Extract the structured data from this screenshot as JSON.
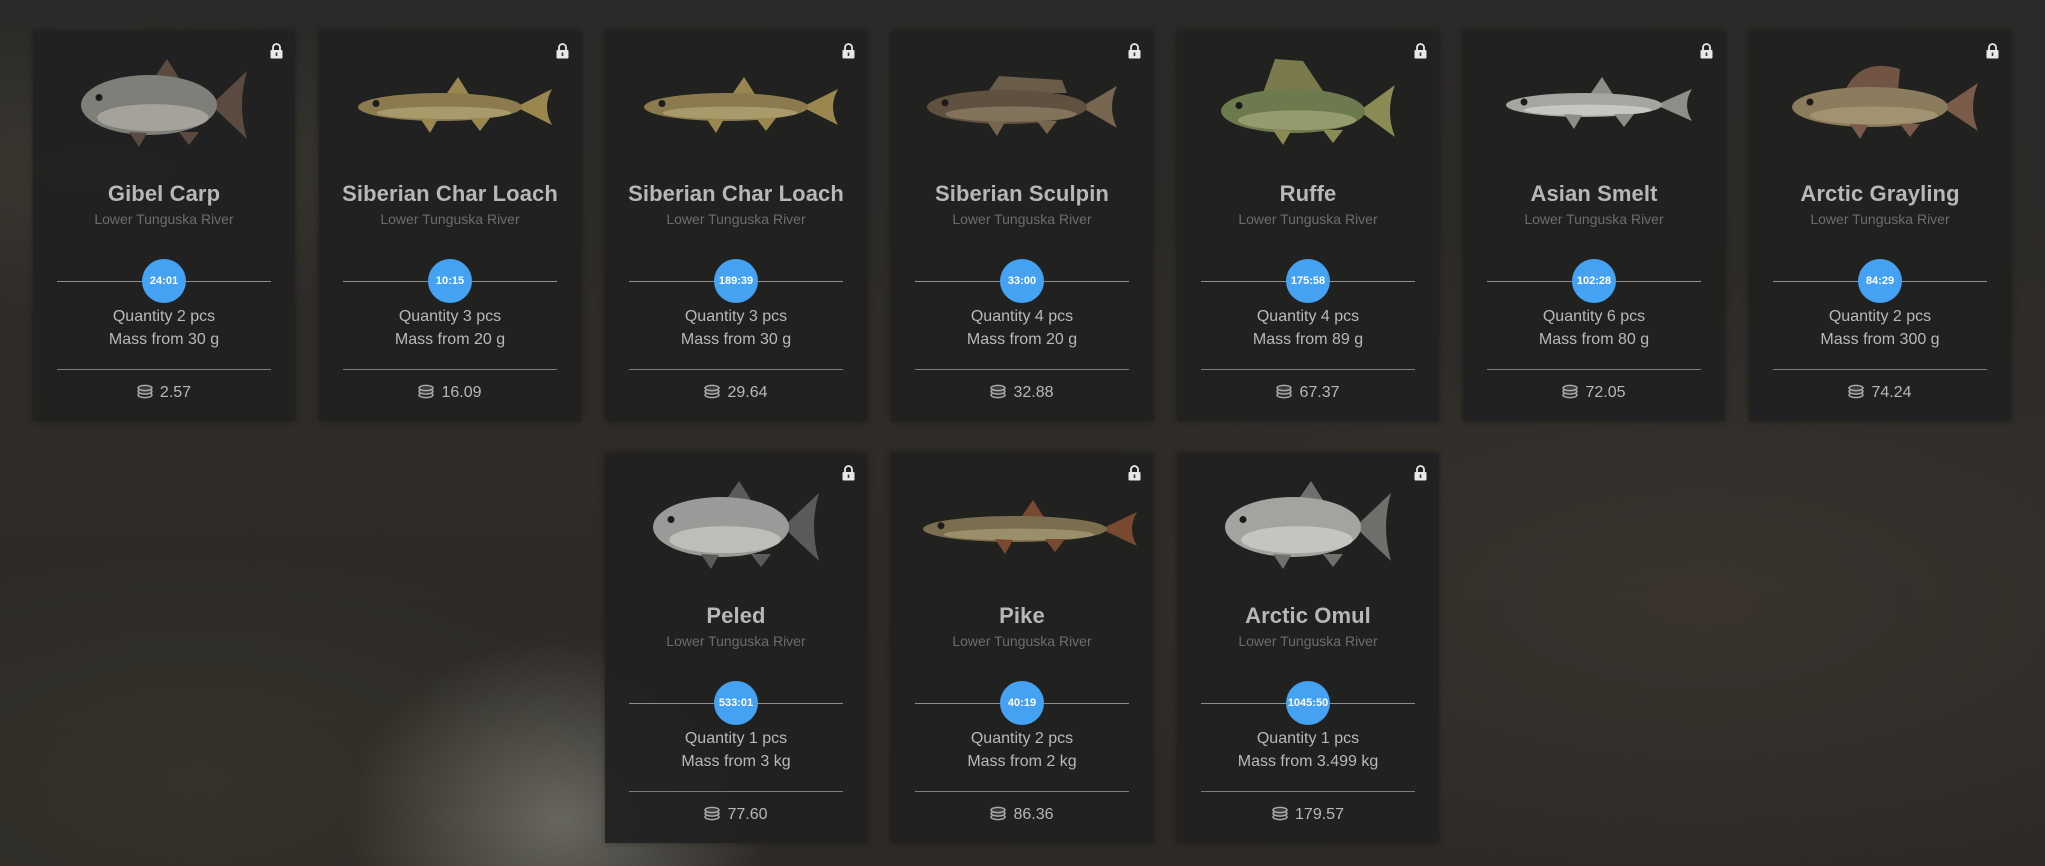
{
  "colors": {
    "accent_timer": "#45a2f2",
    "card_bg": "#202020",
    "name_text": "#b7b7b7",
    "location_text": "#6c6c6c"
  },
  "cards": [
    {
      "name": "Gibel Carp",
      "location": "Lower Tunguska River",
      "timer": "24:01",
      "quantity": "Quantity 2 pcs",
      "mass": "Mass from 30 g",
      "price": "2.57",
      "locked": true,
      "icon": "lock-icon",
      "fish": {
        "body": "#7f7f7a",
        "fin": "#5a4a3f",
        "belly": "#b0aea6",
        "shape": "deep"
      }
    },
    {
      "name": "Siberian Char Loach",
      "location": "Lower Tunguska River",
      "timer": "10:15",
      "quantity": "Quantity 3 pcs",
      "mass": "Mass from 20 g",
      "price": "16.09",
      "locked": true,
      "icon": "lock-icon",
      "fish": {
        "body": "#8a7a4e",
        "fin": "#9a8750",
        "belly": "#b3a577",
        "shape": "long"
      }
    },
    {
      "name": "Siberian Char Loach",
      "location": "Lower Tunguska River",
      "timer": "189:39",
      "quantity": "Quantity 3 pcs",
      "mass": "Mass from 30 g",
      "price": "29.64",
      "locked": true,
      "icon": "lock-icon",
      "fish": {
        "body": "#8a7a4e",
        "fin": "#9a8750",
        "belly": "#b3a577",
        "shape": "long"
      }
    },
    {
      "name": "Siberian Sculpin",
      "location": "Lower Tunguska River",
      "timer": "33:00",
      "quantity": "Quantity 4 pcs",
      "mass": "Mass from 20 g",
      "price": "32.88",
      "locked": true,
      "icon": "lock-icon",
      "fish": {
        "body": "#5e5140",
        "fin": "#766650",
        "belly": "#8e7f66",
        "shape": "sculpin"
      }
    },
    {
      "name": "Ruffe",
      "location": "Lower Tunguska River",
      "timer": "175:58",
      "quantity": "Quantity 4 pcs",
      "mass": "Mass from 89 g",
      "price": "67.37",
      "locked": true,
      "icon": "lock-icon",
      "fish": {
        "body": "#6c7a4e",
        "fin": "#8a8a55",
        "belly": "#a3a77a",
        "shape": "perch"
      }
    },
    {
      "name": "Asian Smelt",
      "location": "Lower Tunguska River",
      "timer": "102:28",
      "quantity": "Quantity 6 pcs",
      "mass": "Mass from 80 g",
      "price": "72.05",
      "locked": true,
      "icon": "lock-icon",
      "fish": {
        "body": "#a5a5a2",
        "fin": "#8d8d8a",
        "belly": "#d2d2ce",
        "shape": "slim"
      }
    },
    {
      "name": "Arctic Grayling",
      "location": "Lower Tunguska River",
      "timer": "84:29",
      "quantity": "Quantity 2 pcs",
      "mass": "Mass from 300 g",
      "price": "74.24",
      "locked": true,
      "icon": "lock-icon",
      "fish": {
        "body": "#8a7c5c",
        "fin": "#7a5a48",
        "belly": "#a89a78",
        "shape": "grayling"
      }
    },
    {
      "name": "Peled",
      "location": "Lower Tunguska River",
      "timer": "533:01",
      "quantity": "Quantity 1 pcs",
      "mass": "Mass from 3 kg",
      "price": "77.60",
      "locked": true,
      "icon": "lock-icon",
      "fish": {
        "body": "#9a9a98",
        "fin": "#5a5a58",
        "belly": "#c8c8c4",
        "shape": "deep"
      }
    },
    {
      "name": "Pike",
      "location": "Lower Tunguska River",
      "timer": "40:19",
      "quantity": "Quantity 2 pcs",
      "mass": "Mass from 2 kg",
      "price": "86.36",
      "locked": true,
      "icon": "lock-icon",
      "fish": {
        "body": "#7a6e4e",
        "fin": "#7a4a30",
        "belly": "#a69a76",
        "shape": "pike"
      }
    },
    {
      "name": "Arctic Omul",
      "location": "Lower Tunguska River",
      "timer": "1045:50",
      "quantity": "Quantity 1 pcs",
      "mass": "Mass from 3.499 kg",
      "price": "179.57",
      "locked": true,
      "icon": "lock-icon",
      "fish": {
        "body": "#a3a3a0",
        "fin": "#6f6f6c",
        "belly": "#cfcfcb",
        "shape": "deep"
      }
    }
  ]
}
